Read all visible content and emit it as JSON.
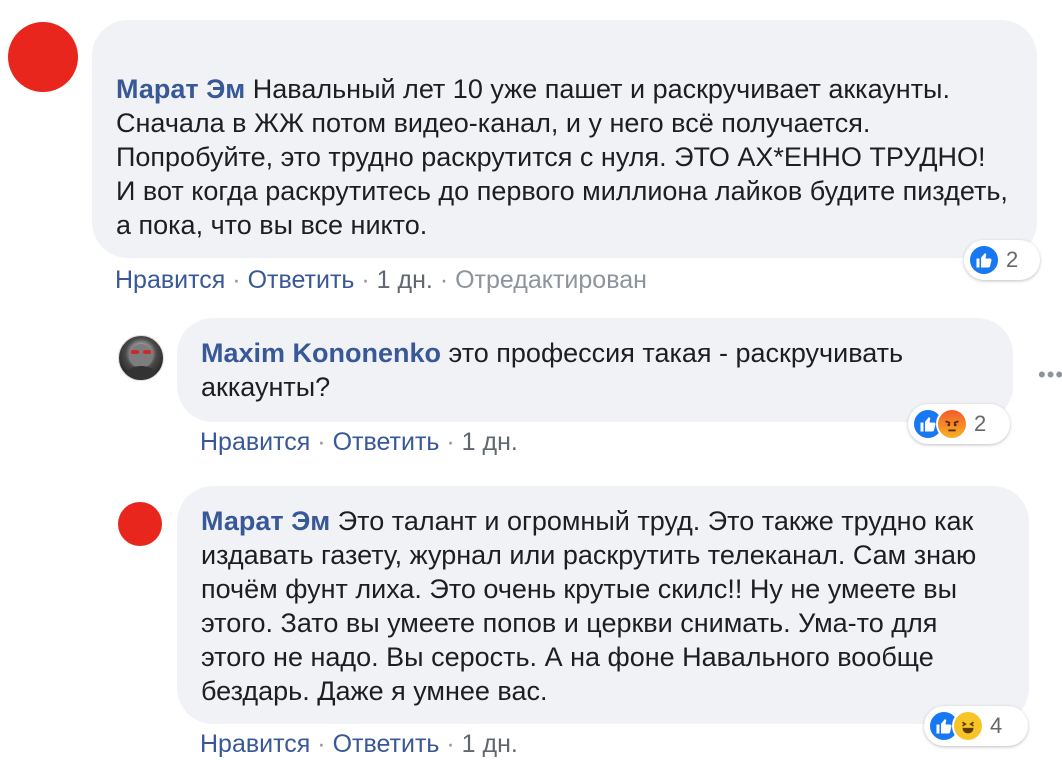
{
  "comments": [
    {
      "author": "Марат Эм",
      "text": " Навальный лет 10 уже пашет и раскручивает аккаунты. Сначала в ЖЖ потом видео-канал, и у него всё получается. Попробуйте, это трудно раскрутится с нуля. ЭТО АХ*ЕННО ТРУДНО!\nИ вот когда раскрутитесь до первого миллиона лайков будите пиздеть, а пока, что вы все никто.",
      "like_label": "Нравится",
      "reply_label": "Ответить",
      "sep": "·",
      "time": "1 дн.",
      "edited": "Отредактирован",
      "reaction_count": "2",
      "reactions": [
        "like-icon"
      ]
    },
    {
      "author": "Maxim Kononenko",
      "text": " это профессия такая - раскручивать аккаунты?",
      "like_label": "Нравится",
      "reply_label": "Ответить",
      "sep": "·",
      "time": "1 дн.",
      "reaction_count": "2",
      "reactions": [
        "like-icon",
        "angry-icon"
      ]
    },
    {
      "author": "Марат Эм",
      "text": " Это талант и огромный труд. Это также трудно как издавать газету, журнал или раскрутить телеканал. Сам знаю почём фунт лиха. Это очень крутые скилс!! Ну не умеете вы этого. Зато вы умеете попов и церкви снимать. Ума-то для этого не надо. Вы серость. А на фоне Навального вообще бездарь. Даже я умнее вас.",
      "like_label": "Нравится",
      "reply_label": "Ответить",
      "sep": "·",
      "time": "1 дн.",
      "reaction_count": "4",
      "reactions": [
        "like-icon",
        "haha-icon"
      ]
    }
  ],
  "colors": {
    "author": "#385898",
    "bubble": "#f0f2f5",
    "like": "#1877f2",
    "avatar_red": "#e8261e"
  }
}
